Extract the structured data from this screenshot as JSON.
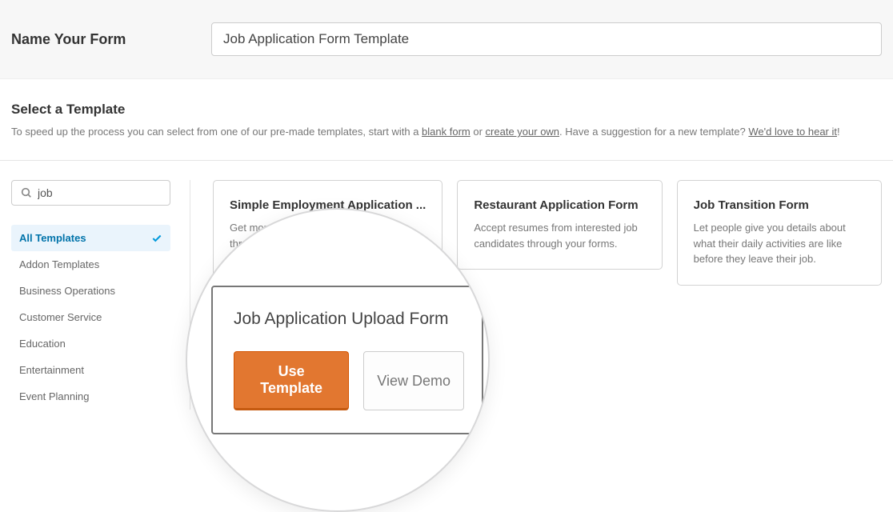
{
  "name_section": {
    "label": "Name Your Form",
    "input_value": "Job Application Form Template"
  },
  "select_section": {
    "title": "Select a Template",
    "desc_prefix": "To speed up the process you can select from one of our pre-made templates, start with a ",
    "blank_link": "blank form",
    "desc_or": " or ",
    "create_link": "create your own",
    "desc_suffix1": ". Have a suggestion for a new template? ",
    "hear_link": "We'd love to hear it",
    "desc_suffix2": "!"
  },
  "search": {
    "value": "job",
    "placeholder": ""
  },
  "categories": [
    {
      "label": "All Templates",
      "active": true
    },
    {
      "label": "Addon Templates",
      "active": false
    },
    {
      "label": "Business Operations",
      "active": false
    },
    {
      "label": "Customer Service",
      "active": false
    },
    {
      "label": "Education",
      "active": false
    },
    {
      "label": "Entertainment",
      "active": false
    },
    {
      "label": "Event Planning",
      "active": false
    }
  ],
  "templates": [
    {
      "title": "Simple Employment Application ...",
      "desc": "Get more applications from candidates through upl"
    },
    {
      "title": "Restaurant Application Form",
      "desc": "Accept resumes from interested job candidates through your forms."
    },
    {
      "title": "Job Transition Form",
      "desc": "Let people give you details about what their daily activities are like before they leave their job."
    }
  ],
  "magnifier": {
    "title": "Job Application Upload Form",
    "use_button": "Use Template",
    "view_button": "View Demo"
  }
}
